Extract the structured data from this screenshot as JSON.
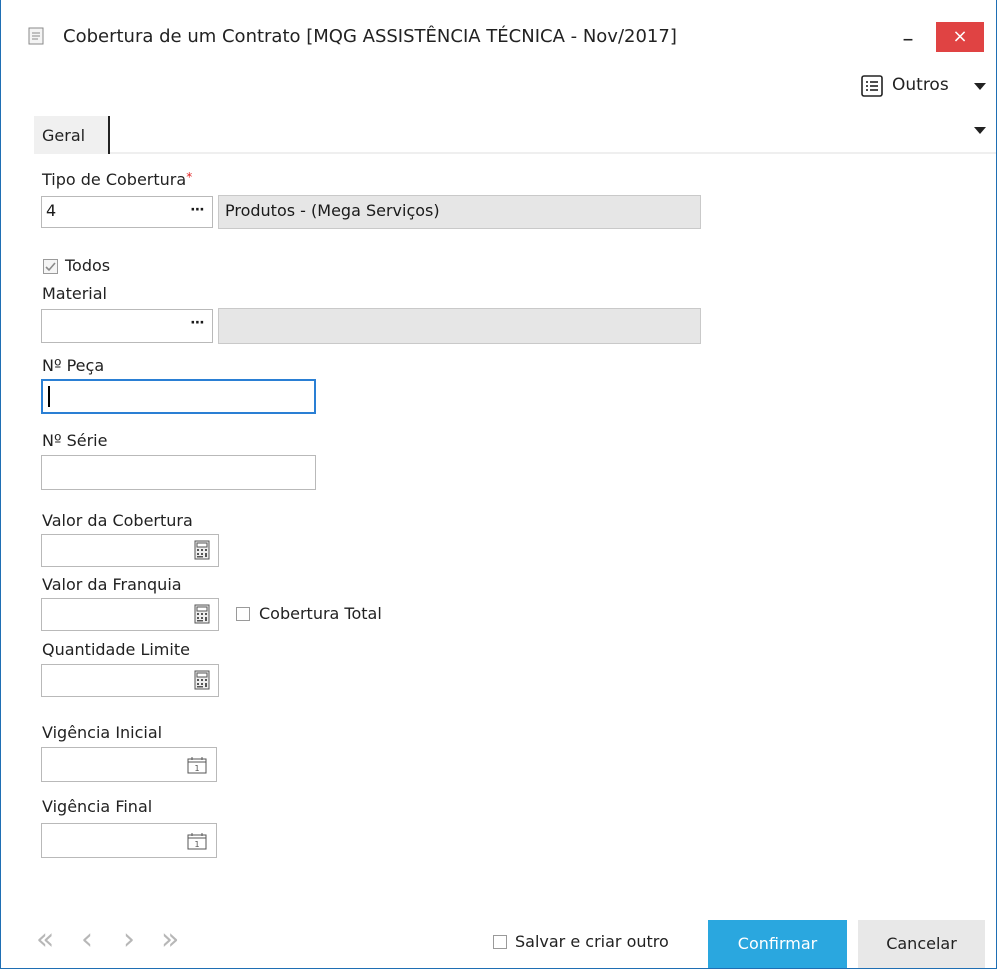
{
  "window": {
    "title": "Cobertura de um Contrato [MQG ASSISTÊNCIA TÉCNICA - Nov/2017]",
    "minimize_glyph": "–",
    "close_glyph": "×"
  },
  "toolbar": {
    "outros_label": "Outros"
  },
  "tabs": [
    {
      "label": "Geral"
    }
  ],
  "form": {
    "tipo_cobertura": {
      "label": "Tipo de Cobertura",
      "required_mark": "*",
      "code": "4",
      "description": "Produtos - (Mega Serviços)"
    },
    "todos": {
      "label": "Todos",
      "checked": true
    },
    "material": {
      "label": "Material",
      "code": "",
      "description": ""
    },
    "numero_peca": {
      "label": "Nº Peça",
      "value": ""
    },
    "numero_serie": {
      "label": "Nº Série",
      "value": ""
    },
    "valor_cobertura": {
      "label": "Valor da Cobertura",
      "value": ""
    },
    "valor_franquia": {
      "label": "Valor da Franquia",
      "value": ""
    },
    "cobertura_total": {
      "label": "Cobertura Total",
      "checked": false
    },
    "quantidade_limite": {
      "label": "Quantidade Limite",
      "value": ""
    },
    "vigencia_inicial": {
      "label": "Vigência Inicial",
      "value": ""
    },
    "vigencia_final": {
      "label": "Vigência Final",
      "value": ""
    }
  },
  "footer": {
    "salvar_criar_outro": {
      "label": "Salvar e criar outro",
      "checked": false
    },
    "confirm_label": "Confirmar",
    "cancel_label": "Cancelar",
    "nav": {
      "first": "«",
      "prev": "‹",
      "next": "›",
      "last": "»"
    }
  },
  "colors": {
    "accent": "#2aa7df",
    "close": "#e04343",
    "focus": "#2a7fd4",
    "required": "#e02020"
  }
}
